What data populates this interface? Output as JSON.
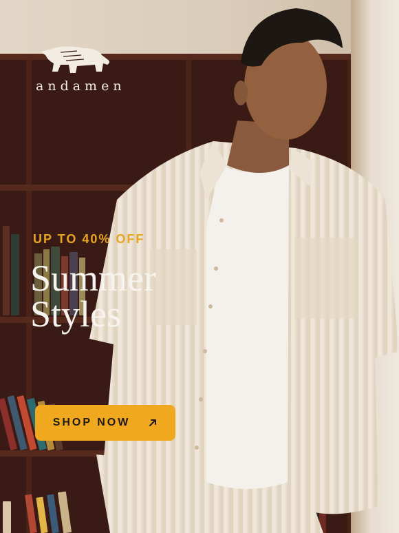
{
  "brand": {
    "logo_icon": "elephant-icon",
    "name": "andamen"
  },
  "promo": {
    "label": "UP TO 40% OFF"
  },
  "headline": {
    "line1": "Summer",
    "line2": "Styles"
  },
  "cta": {
    "label": "SHOP NOW",
    "icon": "arrow-up-right-icon"
  },
  "colors": {
    "accent": "#f0a81e",
    "promo_text": "#e8a521",
    "headline_text": "#f7f3ee"
  }
}
